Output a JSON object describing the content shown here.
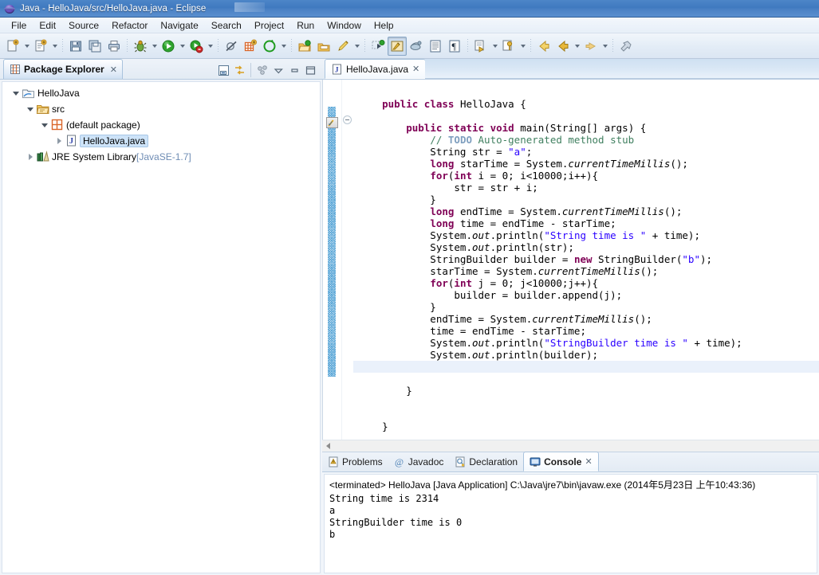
{
  "window": {
    "title": "Java - HelloJava/src/HelloJava.java - Eclipse",
    "app_icon": "eclipse-sphere-icon"
  },
  "menu": {
    "items": [
      "File",
      "Edit",
      "Source",
      "Refactor",
      "Navigate",
      "Search",
      "Project",
      "Run",
      "Window",
      "Help"
    ]
  },
  "toolbar": {
    "groups": [
      {
        "buttons": [
          {
            "name": "new-wizard-button",
            "icon": "new-file-icon",
            "dropdown": true
          },
          {
            "name": "new-java-class-button",
            "icon": "new-class-icon",
            "dropdown": true
          }
        ]
      },
      {
        "buttons": [
          {
            "name": "save-button",
            "icon": "save-disk-icon",
            "dropdown": false
          },
          {
            "name": "save-all-button",
            "icon": "save-all-icon",
            "dropdown": false
          },
          {
            "name": "print-button",
            "icon": "print-icon",
            "dropdown": false
          }
        ]
      },
      {
        "buttons": [
          {
            "name": "debug-button",
            "icon": "bug-icon",
            "dropdown": true
          },
          {
            "name": "run-button",
            "icon": "run-green-play-icon",
            "dropdown": true
          },
          {
            "name": "run-coverage-button",
            "icon": "coverage-icon",
            "dropdown": true
          }
        ]
      },
      {
        "buttons": [
          {
            "name": "skip-breakpoints-button",
            "icon": "skip-breakpoints-icon",
            "dropdown": false
          },
          {
            "name": "new-java-project-button",
            "icon": "new-java-project-icon",
            "dropdown": false
          },
          {
            "name": "new-annotation-button",
            "icon": "new-annotation-icon",
            "dropdown": true
          }
        ]
      },
      {
        "buttons": [
          {
            "name": "open-type-button",
            "icon": "open-type-icon",
            "dropdown": false
          },
          {
            "name": "open-task-button",
            "icon": "open-task-icon",
            "dropdown": false
          },
          {
            "name": "search-button",
            "icon": "search-pencil-icon",
            "dropdown": true
          }
        ]
      },
      {
        "buttons": [
          {
            "name": "next-annotation-button",
            "icon": "next-annotation-icon",
            "dropdown": false
          },
          {
            "name": "java-perspective-button",
            "icon": "java-perspective-icon",
            "dropdown": false,
            "pressed": true
          },
          {
            "name": "java-browsing-button",
            "icon": "java-browsing-icon",
            "dropdown": false
          },
          {
            "name": "toggle-block-selection-button",
            "icon": "block-selection-icon",
            "dropdown": false
          },
          {
            "name": "show-whitespace-button",
            "icon": "whitespace-pilcrow-icon",
            "dropdown": false
          }
        ]
      },
      {
        "buttons": [
          {
            "name": "previous-edit-button",
            "icon": "previous-edit-icon",
            "dropdown": true
          },
          {
            "name": "last-edit-location-button",
            "icon": "last-edit-location-icon",
            "dropdown": true
          }
        ]
      },
      {
        "buttons": [
          {
            "name": "back-button",
            "icon": "back-arrow-icon",
            "dropdown": false
          },
          {
            "name": "forward-history-button",
            "icon": "back-arrow-yellow-icon",
            "dropdown": true
          },
          {
            "name": "forward-button",
            "icon": "forward-arrow-icon",
            "dropdown": true
          }
        ]
      },
      {
        "buttons": [
          {
            "name": "pin-editor-button",
            "icon": "pin-editor-icon",
            "dropdown": false
          }
        ]
      }
    ]
  },
  "package_explorer": {
    "tab_label": "Package Explorer",
    "tab_icon": "package-explorer-icon",
    "close_glyph": "✕",
    "tools": [
      {
        "name": "collapse-all-button",
        "icon": "collapse-all-icon"
      },
      {
        "name": "link-with-editor-button",
        "icon": "link-with-editor-icon"
      },
      {
        "name": "view-menu-button",
        "icon": "view-menu-icon"
      },
      {
        "name": "view-chevron-button",
        "icon": "chevron-down-icon"
      },
      {
        "name": "minimize-view-button",
        "icon": "minimize-icon"
      },
      {
        "name": "maximize-view-button",
        "icon": "maximize-icon"
      }
    ],
    "tree": [
      {
        "label": "HelloJava",
        "icon": "java-project-icon",
        "indent": 0,
        "expanded": true,
        "selected": false
      },
      {
        "label": "src",
        "icon": "source-folder-icon",
        "indent": 1,
        "expanded": true,
        "selected": false
      },
      {
        "label": "(default package)",
        "icon": "package-icon",
        "indent": 2,
        "expanded": true,
        "selected": false
      },
      {
        "label": "HelloJava.java",
        "icon": "java-file-icon",
        "indent": 3,
        "expanded": false,
        "selected": true
      },
      {
        "label": "JRE System Library",
        "suffix": " [JavaSE-1.7]",
        "icon": "jre-library-icon",
        "indent": 1,
        "expanded": false,
        "selected": false
      }
    ]
  },
  "editor": {
    "tab_label": "HelloJava.java",
    "tab_icon": "java-file-icon",
    "close_glyph": "✕",
    "current_line_index": 23,
    "code": [
      {
        "tokens": []
      },
      {
        "tokens": [
          {
            "t": "    ",
            "c": "plain"
          },
          {
            "t": "public",
            "c": "kw"
          },
          {
            "t": " ",
            "c": "plain"
          },
          {
            "t": "class",
            "c": "kw"
          },
          {
            "t": " HelloJava {",
            "c": "plain"
          }
        ]
      },
      {
        "tokens": []
      },
      {
        "tokens": [
          {
            "t": "        ",
            "c": "plain"
          },
          {
            "t": "public",
            "c": "kw"
          },
          {
            "t": " ",
            "c": "plain"
          },
          {
            "t": "static",
            "c": "kw"
          },
          {
            "t": " ",
            "c": "plain"
          },
          {
            "t": "void",
            "c": "kw"
          },
          {
            "t": " main(String[] args) {",
            "c": "plain"
          }
        ]
      },
      {
        "tokens": [
          {
            "t": "            ",
            "c": "plain"
          },
          {
            "t": "// ",
            "c": "cmt"
          },
          {
            "t": "TODO",
            "c": "todo"
          },
          {
            "t": " Auto-generated method stub",
            "c": "cmt"
          }
        ]
      },
      {
        "tokens": [
          {
            "t": "            String str = ",
            "c": "plain"
          },
          {
            "t": "\"a\"",
            "c": "str"
          },
          {
            "t": ";",
            "c": "plain"
          }
        ]
      },
      {
        "tokens": [
          {
            "t": "            ",
            "c": "plain"
          },
          {
            "t": "long",
            "c": "kw"
          },
          {
            "t": " starTime = System.",
            "c": "plain"
          },
          {
            "t": "currentTimeMillis",
            "c": "stat"
          },
          {
            "t": "();",
            "c": "plain"
          }
        ]
      },
      {
        "tokens": [
          {
            "t": "            ",
            "c": "plain"
          },
          {
            "t": "for",
            "c": "kw"
          },
          {
            "t": "(",
            "c": "plain"
          },
          {
            "t": "int",
            "c": "kw"
          },
          {
            "t": " i = ",
            "c": "plain"
          },
          {
            "t": "0",
            "c": "plain"
          },
          {
            "t": "; i<",
            "c": "plain"
          },
          {
            "t": "10000",
            "c": "plain"
          },
          {
            "t": ";i++){",
            "c": "plain"
          }
        ]
      },
      {
        "tokens": [
          {
            "t": "                str = str + i;",
            "c": "plain"
          }
        ]
      },
      {
        "tokens": [
          {
            "t": "            }",
            "c": "plain"
          }
        ]
      },
      {
        "tokens": [
          {
            "t": "            ",
            "c": "plain"
          },
          {
            "t": "long",
            "c": "kw"
          },
          {
            "t": " endTime = System.",
            "c": "plain"
          },
          {
            "t": "currentTimeMillis",
            "c": "stat"
          },
          {
            "t": "();",
            "c": "plain"
          }
        ]
      },
      {
        "tokens": [
          {
            "t": "            ",
            "c": "plain"
          },
          {
            "t": "long",
            "c": "kw"
          },
          {
            "t": " time = endTime - starTime;",
            "c": "plain"
          }
        ]
      },
      {
        "tokens": [
          {
            "t": "            System.",
            "c": "plain"
          },
          {
            "t": "out",
            "c": "stat"
          },
          {
            "t": ".println(",
            "c": "plain"
          },
          {
            "t": "\"String time is \"",
            "c": "str"
          },
          {
            "t": " + time);",
            "c": "plain"
          }
        ]
      },
      {
        "tokens": [
          {
            "t": "            System.",
            "c": "plain"
          },
          {
            "t": "out",
            "c": "stat"
          },
          {
            "t": ".println(str);",
            "c": "plain"
          }
        ]
      },
      {
        "tokens": [
          {
            "t": "            StringBuilder builder = ",
            "c": "plain"
          },
          {
            "t": "new",
            "c": "kw"
          },
          {
            "t": " StringBuilder(",
            "c": "plain"
          },
          {
            "t": "\"b\"",
            "c": "str"
          },
          {
            "t": ");",
            "c": "plain"
          }
        ]
      },
      {
        "tokens": [
          {
            "t": "            starTime = System.",
            "c": "plain"
          },
          {
            "t": "currentTimeMillis",
            "c": "stat"
          },
          {
            "t": "();",
            "c": "plain"
          }
        ]
      },
      {
        "tokens": [
          {
            "t": "            ",
            "c": "plain"
          },
          {
            "t": "for",
            "c": "kw"
          },
          {
            "t": "(",
            "c": "plain"
          },
          {
            "t": "int",
            "c": "kw"
          },
          {
            "t": " j = ",
            "c": "plain"
          },
          {
            "t": "0",
            "c": "plain"
          },
          {
            "t": "; j<",
            "c": "plain"
          },
          {
            "t": "10000",
            "c": "plain"
          },
          {
            "t": ";j++){",
            "c": "plain"
          }
        ]
      },
      {
        "tokens": [
          {
            "t": "                builder = builder.append(j);",
            "c": "plain"
          }
        ]
      },
      {
        "tokens": [
          {
            "t": "            }",
            "c": "plain"
          }
        ]
      },
      {
        "tokens": [
          {
            "t": "            endTime = System.",
            "c": "plain"
          },
          {
            "t": "currentTimeMillis",
            "c": "stat"
          },
          {
            "t": "();",
            "c": "plain"
          }
        ]
      },
      {
        "tokens": [
          {
            "t": "            time = endTime - starTime;",
            "c": "plain"
          }
        ]
      },
      {
        "tokens": [
          {
            "t": "            System.",
            "c": "plain"
          },
          {
            "t": "out",
            "c": "stat"
          },
          {
            "t": ".println(",
            "c": "plain"
          },
          {
            "t": "\"StringBuilder time is \"",
            "c": "str"
          },
          {
            "t": " + time);",
            "c": "plain"
          }
        ]
      },
      {
        "tokens": [
          {
            "t": "            System.",
            "c": "plain"
          },
          {
            "t": "out",
            "c": "stat"
          },
          {
            "t": ".println(builder);",
            "c": "plain"
          }
        ]
      },
      {
        "tokens": []
      },
      {
        "tokens": []
      },
      {
        "tokens": [
          {
            "t": "        }",
            "c": "plain"
          }
        ]
      },
      {
        "tokens": []
      },
      {
        "tokens": []
      },
      {
        "tokens": [
          {
            "t": "    }",
            "c": "plain"
          }
        ]
      }
    ]
  },
  "console": {
    "tabs": [
      {
        "label": "Problems",
        "icon": "problems-icon",
        "active": false
      },
      {
        "label": "Javadoc",
        "icon": "javadoc-at-icon",
        "active": false
      },
      {
        "label": "Declaration",
        "icon": "declaration-icon",
        "active": false
      },
      {
        "label": "Console",
        "icon": "console-monitor-icon",
        "active": true
      }
    ],
    "close_glyph": "✕",
    "header": "<terminated> HelloJava [Java Application] C:\\Java\\jre7\\bin\\javaw.exe (2014年5月23日 上午10:43:36)",
    "output": [
      "String time is 2314",
      "a",
      "StringBuilder time is 0",
      "b"
    ]
  },
  "colors": {
    "title_bar": "#4178bf",
    "keyword": "#7f0055",
    "string": "#2a00ff",
    "comment": "#3f7f5f",
    "todo": "#7f9fbf",
    "accent": "#cde3f8"
  }
}
